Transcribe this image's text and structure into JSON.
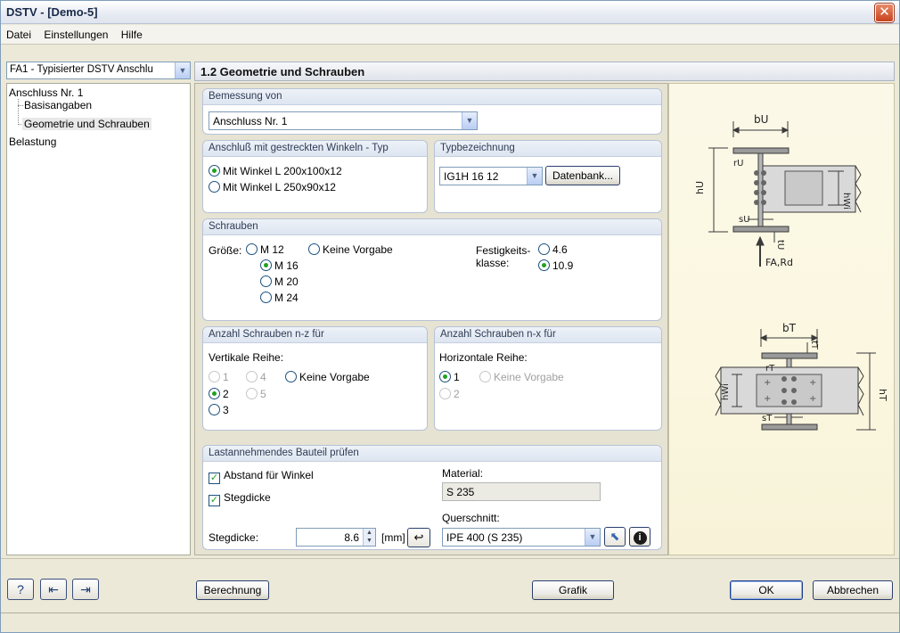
{
  "window": {
    "title": "DSTV - [Demo-5]"
  },
  "menu": {
    "datei": "Datei",
    "einstellungen": "Einstellungen",
    "hilfe": "Hilfe"
  },
  "nav": {
    "combo_value": "FA1 - Typisierter DSTV Anschlu",
    "tree": {
      "root": "Anschluss Nr. 1",
      "child1": "Basisangaben",
      "child2": "Geometrie und Schrauben",
      "belastung": "Belastung"
    }
  },
  "section_title": "1.2 Geometrie und Schrauben",
  "bemessung": {
    "title": "Bemessung von",
    "value": "Anschluss Nr. 1"
  },
  "winkel": {
    "title": "Anschluß mit gestreckten Winkeln - Typ",
    "opt1": "Mit Winkel L 200x100x12",
    "opt2": "Mit Winkel L 250x90x12"
  },
  "typ": {
    "title": "Typbezeichnung",
    "value": "IG1H 16 12",
    "datenbank": "Datenbank..."
  },
  "schrauben": {
    "title": "Schrauben",
    "groesse_label": "Größe:",
    "m12": "M 12",
    "m16": "M 16",
    "m20": "M 20",
    "m24": "M 24",
    "keine": "Keine Vorgabe",
    "fest_label1": "Festigkeits-",
    "fest_label2": "klasse:",
    "k46": "4.6",
    "k109": "10.9"
  },
  "nz": {
    "title": "Anzahl Schrauben n-z für",
    "label": "Vertikale Reihe:",
    "o1": "1",
    "o4": "4",
    "o2": "2",
    "o5": "5",
    "o3": "3",
    "keine": "Keine Vorgabe"
  },
  "nx": {
    "title": "Anzahl Schrauben n-x für",
    "label": "Horizontale Reihe:",
    "o1": "1",
    "o2": "2",
    "keine": "Keine Vorgabe"
  },
  "last": {
    "title": "Lastannehmendes Bauteil prüfen",
    "abstand": "Abstand für Winkel",
    "stegdicke_chk": "Stegdicke",
    "material_label": "Material:",
    "material_value": "S 235",
    "querschnitt_label": "Querschnitt:",
    "querschnitt_value": "IPE 400 (S 235)",
    "stegdicke_label": "Stegdicke:",
    "stegdicke_value": "8.6",
    "unit": "[mm]"
  },
  "diagram": {
    "bu": "bU",
    "ru": "rU",
    "hwi": "hWi",
    "hu": "hU",
    "su": "sU",
    "tu": "tU",
    "fa": "FA,Rd",
    "bt": "bT",
    "tt": "tT",
    "rt": "rT",
    "ht": "hT",
    "st": "sT"
  },
  "footer": {
    "berechnung": "Berechnung",
    "grafik": "Grafik",
    "ok": "OK",
    "abbrechen": "Abbrechen"
  }
}
